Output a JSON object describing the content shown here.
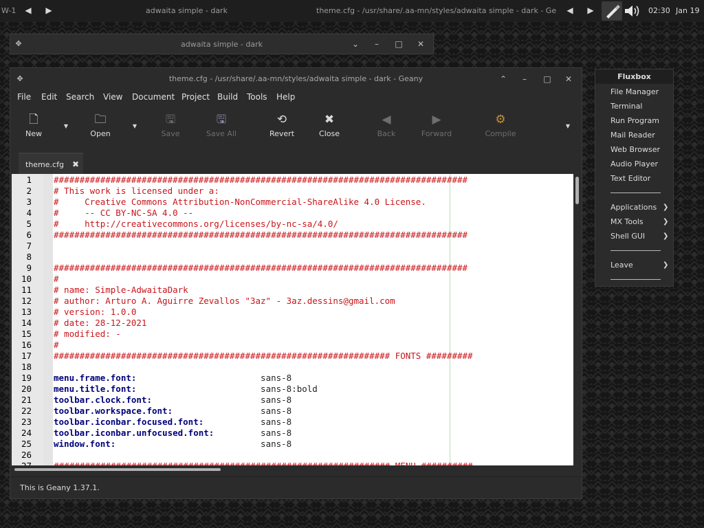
{
  "topbar": {
    "workspace": "W-1",
    "task1": "adwaita simple - dark",
    "task2": "theme.cfg - /usr/share/.aa-mn/styles/adwaita simple - dark - Ge",
    "time": "02:30",
    "date": "Jan 19"
  },
  "window2": {
    "title": "adwaita simple - dark"
  },
  "geany": {
    "title": "theme.cfg - /usr/share/.aa-mn/styles/adwaita simple - dark - Geany",
    "menu": [
      "File",
      "Edit",
      "Search",
      "View",
      "Document",
      "Project",
      "Build",
      "Tools",
      "Help"
    ],
    "toolbar": {
      "new": "New",
      "open": "Open",
      "save": "Save",
      "save_all": "Save All",
      "revert": "Revert",
      "close": "Close",
      "back": "Back",
      "forward": "Forward",
      "compile": "Compile"
    },
    "tab": "theme.cfg",
    "status": "This is Geany 1.37.1."
  },
  "editor": {
    "lines": [
      {
        "n": "1",
        "t": "cm",
        "text": "################################################################################"
      },
      {
        "n": "2",
        "t": "cm",
        "text": "# This work is licensed under a:"
      },
      {
        "n": "3",
        "t": "cm",
        "text": "#     Creative Commons Attribution-NonCommercial-ShareAlike 4.0 License."
      },
      {
        "n": "4",
        "t": "cm",
        "text": "#     -- CC BY-NC-SA 4.0 --"
      },
      {
        "n": "5",
        "t": "cm",
        "text": "#     http://creativecommons.org/licenses/by-nc-sa/4.0/"
      },
      {
        "n": "6",
        "t": "cm",
        "text": "################################################################################"
      },
      {
        "n": "7",
        "t": "cm",
        "text": ""
      },
      {
        "n": "8",
        "t": "cm",
        "text": ""
      },
      {
        "n": "9",
        "t": "cm",
        "text": "################################################################################"
      },
      {
        "n": "10",
        "t": "cm",
        "text": "#"
      },
      {
        "n": "11",
        "t": "cm",
        "text": "# name: Simple-AdwaitaDark"
      },
      {
        "n": "12",
        "t": "cm",
        "text": "# author: Arturo A. Aguirre Zevallos \"3az\" - 3az.dessins@gmail.com"
      },
      {
        "n": "13",
        "t": "cm",
        "text": "# version: 1.0.0"
      },
      {
        "n": "14",
        "t": "cm",
        "text": "# date: 28-12-2021"
      },
      {
        "n": "15",
        "t": "cm",
        "text": "# modified: -"
      },
      {
        "n": "16",
        "t": "cm",
        "text": "#"
      },
      {
        "n": "17",
        "t": "cm",
        "text": "################################################################# FONTS #########"
      },
      {
        "n": "18",
        "t": "cm",
        "text": ""
      },
      {
        "n": "19",
        "t": "kv",
        "key": "menu.frame.font",
        "sep": ":",
        "pad": "                        ",
        "val": "sans-8"
      },
      {
        "n": "20",
        "t": "kv",
        "key": "menu.title.font",
        "sep": ":",
        "pad": "                        ",
        "val": "sans-8:bold"
      },
      {
        "n": "21",
        "t": "kv",
        "key": "toolbar.clock.font",
        "sep": ":",
        "pad": "                     ",
        "val": "sans-8"
      },
      {
        "n": "22",
        "t": "kv",
        "key": "toolbar.workspace.font",
        "sep": ":",
        "pad": "                 ",
        "val": "sans-8"
      },
      {
        "n": "23",
        "t": "kv",
        "key": "toolbar.iconbar.focused.font",
        "sep": ":",
        "pad": "           ",
        "val": "sans-8"
      },
      {
        "n": "24",
        "t": "kv",
        "key": "toolbar.iconbar.unfocused.font",
        "sep": ":",
        "pad": "         ",
        "val": "sans-8"
      },
      {
        "n": "25",
        "t": "kv",
        "key": "window.font",
        "sep": ":",
        "pad": "                            ",
        "val": "sans-8"
      },
      {
        "n": "26",
        "t": "cm",
        "text": ""
      },
      {
        "n": "27",
        "t": "cm",
        "text": "################################################################# MENU ##########"
      }
    ]
  },
  "fluxbox": {
    "title": "Fluxbox",
    "items": [
      "File Manager",
      "Terminal",
      "Run Program",
      "Mail Reader",
      "Web Browser",
      "Audio Player",
      "Text Editor"
    ],
    "submenus": [
      "Applications",
      "MX Tools",
      "Shell GUI"
    ],
    "leave": "Leave"
  },
  "colors": {
    "comment": "#c81418",
    "key": "#00007c"
  }
}
